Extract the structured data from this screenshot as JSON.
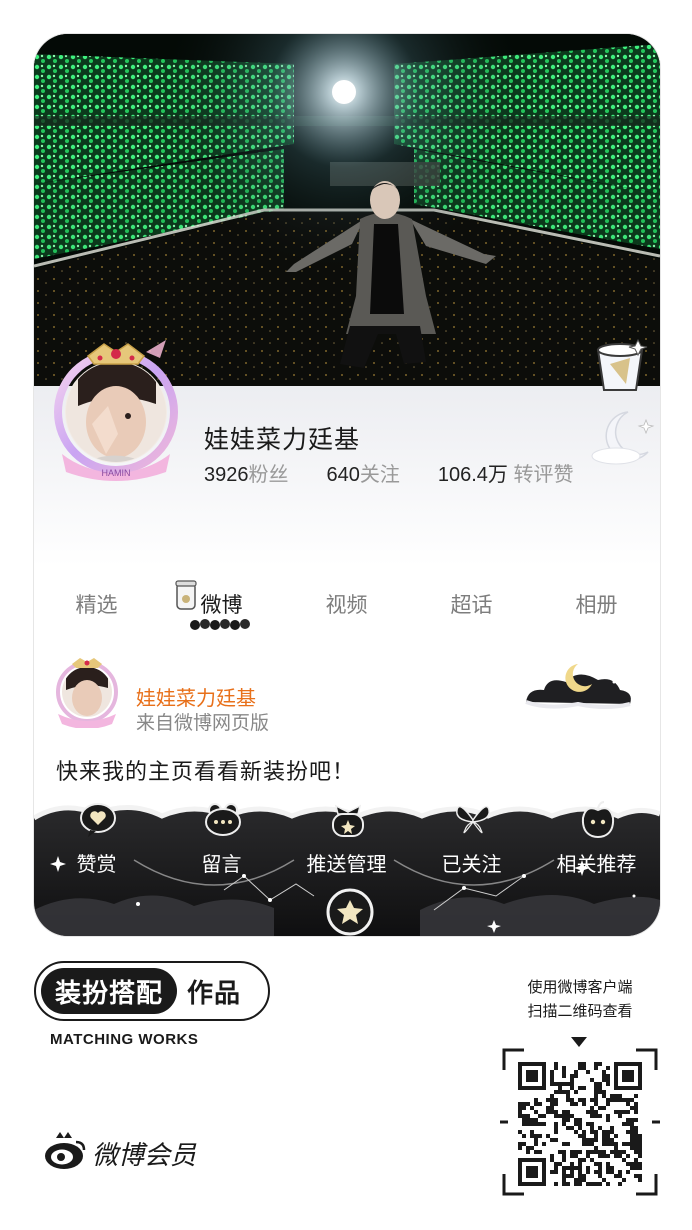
{
  "profile": {
    "username": "娃娃菜力廷基",
    "stats": [
      {
        "num": "3926",
        "label": "粉丝"
      },
      {
        "num": "640",
        "label": "关注"
      },
      {
        "num": "106.4万",
        "label": "转评赞"
      }
    ]
  },
  "tabs": [
    {
      "label": "精选",
      "active": false
    },
    {
      "label": "微博",
      "active": true
    },
    {
      "label": "视频",
      "active": false
    },
    {
      "label": "超话",
      "active": false
    },
    {
      "label": "相册",
      "active": false
    }
  ],
  "post": {
    "author": "娃娃菜力廷基",
    "source": "来自微博网页版",
    "text": "快来我的主页看看新装扮吧！"
  },
  "actions": [
    {
      "label": "赞赏",
      "icon": "heart-bubble-icon"
    },
    {
      "label": "留言",
      "icon": "frog-bubble-icon"
    },
    {
      "label": "推送管理",
      "icon": "bow-bubble-icon"
    },
    {
      "label": "已关注",
      "icon": "butterfly-icon"
    },
    {
      "label": "相关推荐",
      "icon": "apple-bubble-icon"
    }
  ],
  "branding": {
    "pill": "装扮搭配",
    "suffix": "作品",
    "subtitle": "MATCHING WORKS",
    "vip": "微博会员",
    "avatar_caption": "HAMIN"
  },
  "qr": {
    "hint_line1": "使用微博客户端",
    "hint_line2": "扫描二维码查看"
  },
  "colors": {
    "accent_orange": "#e8701a",
    "stage_green": "#2fd46a",
    "text_dark": "#1a1a1a",
    "muted": "#999999"
  }
}
